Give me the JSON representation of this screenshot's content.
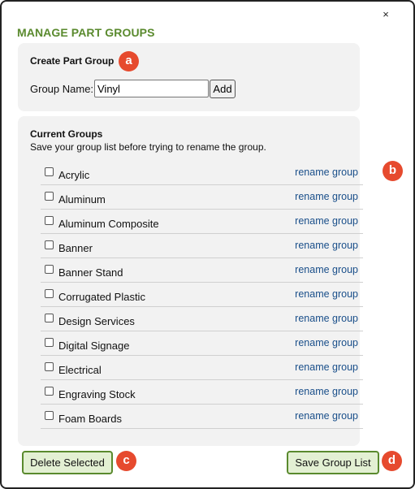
{
  "dialog": {
    "close_glyph": "×",
    "title": "MANAGE PART GROUPS"
  },
  "create": {
    "heading": "Create Part Group",
    "group_name_label": "Group Name:",
    "group_name_value": "Vinyl",
    "add_label": "Add"
  },
  "groups": {
    "heading": "Current Groups",
    "note": "Save your group list before trying to rename the group.",
    "rename_label": "rename group",
    "items": [
      {
        "name": "Acrylic",
        "checked": false
      },
      {
        "name": "Aluminum",
        "checked": false
      },
      {
        "name": "Aluminum Composite",
        "checked": false
      },
      {
        "name": "Banner",
        "checked": false
      },
      {
        "name": "Banner Stand",
        "checked": false
      },
      {
        "name": "Corrugated Plastic",
        "checked": false
      },
      {
        "name": "Design Services",
        "checked": false
      },
      {
        "name": "Digital Signage",
        "checked": false
      },
      {
        "name": "Electrical",
        "checked": false
      },
      {
        "name": "Engraving Stock",
        "checked": false
      },
      {
        "name": "Foam Boards",
        "checked": false
      }
    ]
  },
  "footer": {
    "delete_label": "Delete Selected",
    "save_label": "Save Group List"
  },
  "annotations": {
    "a": "a",
    "b": "b",
    "c": "c",
    "d": "d"
  },
  "colors": {
    "title": "#5a8a2e",
    "link": "#1a4f8a",
    "badge": "#e64a2e",
    "button_bg": "#e3f0d3",
    "button_border": "#5a8a2e",
    "panel_bg": "#f2f2f2"
  }
}
